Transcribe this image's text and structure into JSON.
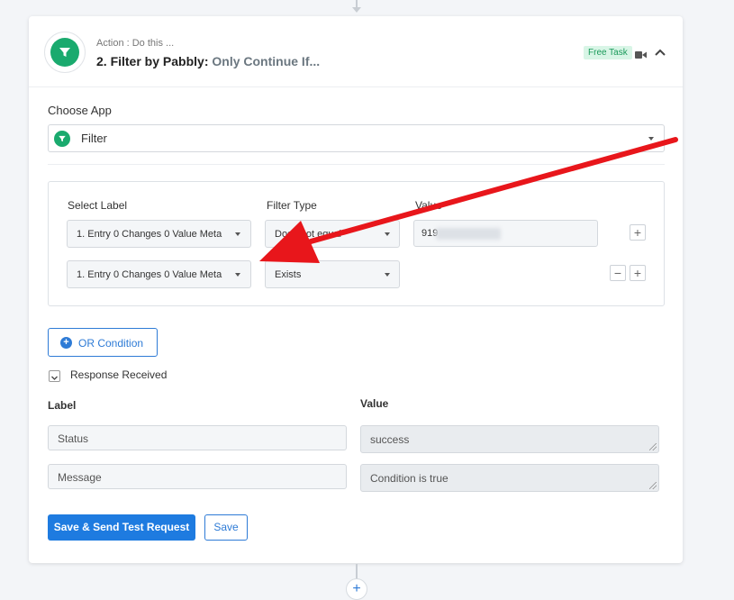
{
  "step": {
    "kind": "Action : Do this ...",
    "title": "2. Filter by Pabbly:",
    "subtitle": "Only Continue If...",
    "badge": "Free Task"
  },
  "choose_app": {
    "label": "Choose App",
    "value": "Filter"
  },
  "filter": {
    "headers": {
      "select_label": "Select Label",
      "filter_type": "Filter Type",
      "value": "Value"
    },
    "rows": [
      {
        "label": "1. Entry 0 Changes 0 Value Meta",
        "type": "Does not equal",
        "value": "919"
      },
      {
        "label": "1. Entry 0 Changes 0 Value Meta",
        "type": "Exists"
      }
    ]
  },
  "or_condition": "OR Condition",
  "response": {
    "title": "Response Received",
    "label_header": "Label",
    "value_header": "Value",
    "rows": [
      {
        "label": "Status",
        "value": "success"
      },
      {
        "label": "Message",
        "value": "Condition is true"
      }
    ]
  },
  "buttons": {
    "save_send": "Save & Send Test Request",
    "save": "Save"
  },
  "colors": {
    "accent": "#1e7be0",
    "brand_green": "#1aaa6e",
    "annotation_arrow": "#e8161b"
  },
  "icons": {
    "app_logo": "filter-funnel-icon",
    "video": "video-camera-icon",
    "collapse": "chevron-up-icon",
    "add": "plus-icon",
    "remove": "minus-icon"
  }
}
